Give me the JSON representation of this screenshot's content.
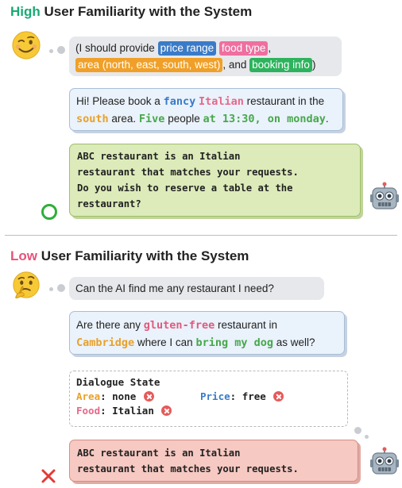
{
  "high": {
    "heading_accent": "High",
    "heading_rest": " User Familiarity with the System",
    "thought": {
      "open": "(I should provide ",
      "tag_price": "price range",
      "tag_food": "food type",
      "comma": ",",
      "tag_area": "area (north, east, south, west)",
      "and": ", and ",
      "tag_booking": "booking info",
      "close": ")"
    },
    "user": {
      "p1": "Hi! Please book a ",
      "fancy": "fancy",
      "italian": "Italian",
      "p2": " restaurant in the",
      "south": "south",
      "p3": " area. ",
      "five": "Five",
      "p4": " people ",
      "time": "at 13:30, on monday",
      "p5": "."
    },
    "bot": {
      "line1": "ABC restaurant is an Italian",
      "line2": "restaurant that matches your requests.",
      "line3": "Do you wish to reserve a table at the",
      "line4": "restaurant?"
    }
  },
  "low": {
    "heading_accent": "Low",
    "heading_rest": " User Familiarity with the System",
    "thought": "Can the AI find me any restaurant I need?",
    "user": {
      "p1": "Are there any ",
      "gluten": "gluten-free",
      "p2": " restaurant in",
      "cambridge": "Cambridge",
      "p3": " where I can ",
      "dog": "bring my dog",
      "p4": " as well?"
    },
    "state": {
      "title": "Dialogue State",
      "area_key": "Area",
      "area_val": ": none",
      "price_key": "Price",
      "price_val": ": free",
      "food_key": "Food",
      "food_val": ": Italian"
    },
    "bot": {
      "line1": "ABC restaurant is an Italian",
      "line2": "restaurant that matches your requests."
    }
  },
  "colors": {
    "high_accent": "#19a974",
    "low_accent": "#e8527a",
    "price_tag": "#3a7bc8",
    "food_tag": "#ef6fa0",
    "area_tag": "#f0a028",
    "booking_tag": "#2db35d",
    "success_mark": "#2fae3a",
    "fail_mark": "#e53935"
  },
  "icons": {
    "wink_face": "winking-face-icon",
    "thinking_face": "thinking-face-icon",
    "robot": "robot-icon",
    "success": "circle-check-icon",
    "fail": "x-cross-icon"
  }
}
